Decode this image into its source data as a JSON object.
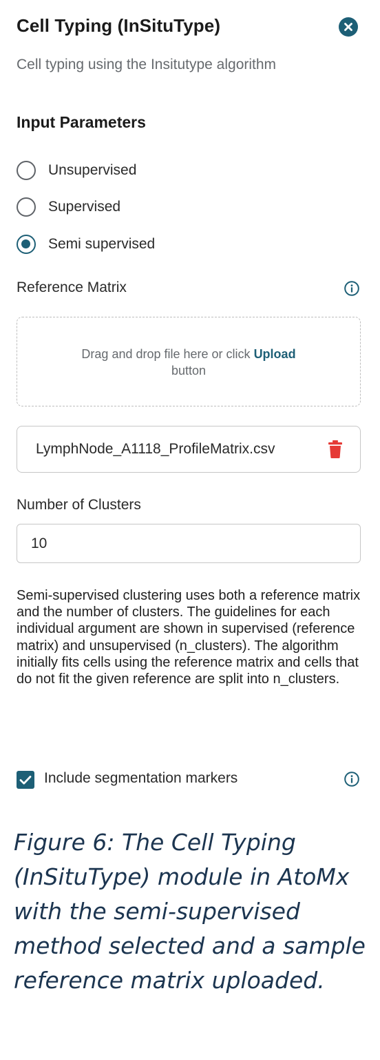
{
  "header": {
    "title": "Cell Typing (InSituType)",
    "subtitle": "Cell typing using the Insitutype algorithm",
    "close_icon": "close-circle-icon"
  },
  "parameters": {
    "section_title": "Input Parameters",
    "mode_options": [
      {
        "label": "Unsupervised",
        "selected": false
      },
      {
        "label": "Supervised",
        "selected": false
      },
      {
        "label": "Semi supervised",
        "selected": true
      }
    ],
    "reference_matrix": {
      "label": "Reference Matrix",
      "info_icon": "info-icon",
      "dropzone_text": "Drag and drop file here or click",
      "dropzone_link": "Upload",
      "dropzone_suffix": "button",
      "uploaded_file": "LymphNode_A1118_ProfileMatrix.csv",
      "delete_icon": "trash-icon"
    },
    "clusters": {
      "label": "Number of Clusters",
      "value": "10"
    },
    "description": "Semi-supervised clustering uses both a reference matrix and the number of clusters. The guidelines for each individual argument are shown in supervised (reference matrix) and unsupervised (n_clusters). The algorithm initially fits cells using the reference matrix and cells that do not fit the given reference are split into n_clusters.",
    "segmentation": {
      "label": "Include segmentation markers",
      "checked": true,
      "info_icon": "info-icon"
    }
  },
  "caption": "Figure 6: The Cell Typing (InSituType) module in AtoMx with the semi-supervised method selected and a sample reference matrix uploaded.",
  "colors": {
    "accent": "#1d5f76",
    "delete": "#e53935",
    "caption": "#1c3550"
  }
}
